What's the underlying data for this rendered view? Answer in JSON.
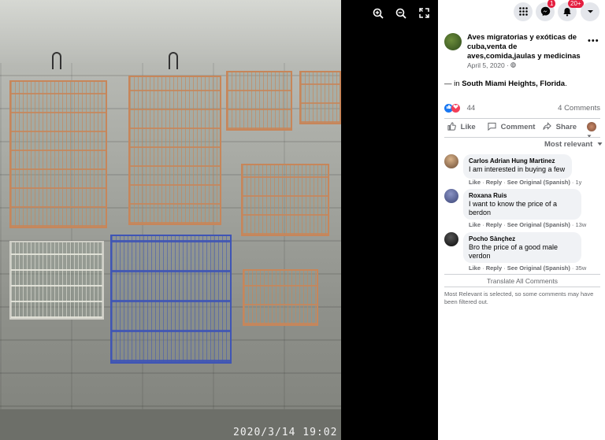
{
  "viewer": {
    "timestamp": "2020/3/14  19:02",
    "zoom_in_icon": "zoom-in-icon",
    "zoom_out_icon": "zoom-out-icon",
    "fullscreen_icon": "fullscreen-icon"
  },
  "topbar": {
    "messenger_badge": "1",
    "notifications_badge": "20+"
  },
  "post": {
    "page_name": "Aves migratorias y exóticas de cuba,venta de aves,comida,jaulas y medicinas",
    "date": "April 5, 2020 · ",
    "location_prefix": "— in ",
    "location": "South Miami Heights, Florida",
    "location_suffix": ".",
    "reaction_count": "44",
    "comments_count": "4 Comments",
    "actions": {
      "like": "Like",
      "comment": "Comment",
      "share": "Share"
    },
    "sort_label": "Most relevant"
  },
  "comments": [
    {
      "name": "Carlos Adrian Hung Martinez",
      "text": "I am interested in buying a few",
      "like": "Like",
      "reply": "Reply",
      "see_original": "See Original (Spanish)",
      "time": "1y"
    },
    {
      "name": "Roxana Ruis",
      "text": "I want to know the price of a berdon",
      "like": "Like",
      "reply": "Reply",
      "see_original": "See Original (Spanish)",
      "time": "13w"
    },
    {
      "name": "Pocho Sànçhez",
      "text": "Bro the price of a good male verdon",
      "like": "Like",
      "reply": "Reply",
      "see_original": "See Original (Spanish)",
      "time": "35w"
    }
  ],
  "translate_all": "Translate All Comments",
  "notice": "Most Relevant is selected, so some comments may have been filtered out.",
  "colors": {
    "accent": "#1877f2",
    "badge": "#e41e3f",
    "panel_bg": "#ffffff"
  }
}
